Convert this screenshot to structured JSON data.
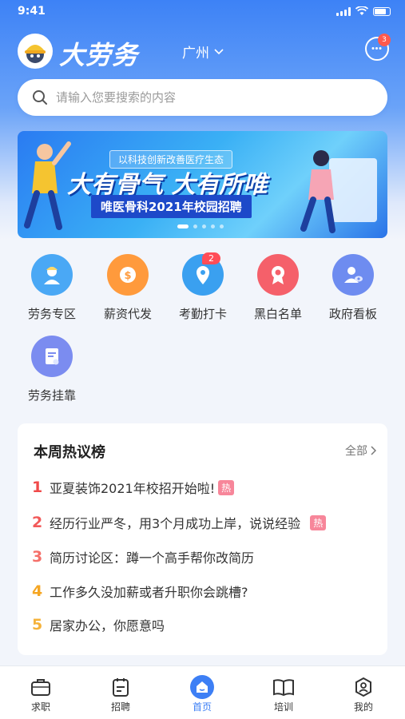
{
  "status_bar": {
    "time": "9:41"
  },
  "header": {
    "brand": "大劳务",
    "city": "广州",
    "message_badge": "3"
  },
  "search": {
    "placeholder": "请输入您要搜索的内容"
  },
  "banner": {
    "subtitle": "以科技创新改善医疗生态",
    "headline": "大有骨气 大有所唯",
    "campaign": "唯医骨科2021年校园招聘",
    "slides": 5,
    "active_slide": 1
  },
  "quick_menu": [
    {
      "label": "劳务专区",
      "icon": "worker-icon",
      "color": "#4aa8f5"
    },
    {
      "label": "薪资代发",
      "icon": "salary-coin-icon",
      "color": "#ff9a3c"
    },
    {
      "label": "考勤打卡",
      "icon": "location-pin-icon",
      "color": "#3aa0f0",
      "badge": "2"
    },
    {
      "label": "黑白名单",
      "icon": "ribbon-badge-icon",
      "color": "#f5606a"
    },
    {
      "label": "政府看板",
      "icon": "person-eye-icon",
      "color": "#6e8cf0"
    },
    {
      "label": "劳务挂靠",
      "icon": "document-icon",
      "color": "#7b8cf0"
    }
  ],
  "hot_list": {
    "title": "本周热议榜",
    "more_label": "全部",
    "hot_tag": "热",
    "items": [
      {
        "rank": "1",
        "text": "亚夏装饰2021年校招开始啦!",
        "hot": true,
        "rank_color": "#f04a4a"
      },
      {
        "rank": "2",
        "text": "经历行业严冬，用3个月成功上岸，说说经验",
        "hot": true,
        "rank_color": "#f25a5a"
      },
      {
        "rank": "3",
        "text": "简历讨论区：蹲一个高手帮你改简历",
        "hot": false,
        "rank_color": "#f5706a"
      },
      {
        "rank": "4",
        "text": "工作多久没加薪或者升职你会跳槽?",
        "hot": false,
        "rank_color": "#f5a623"
      },
      {
        "rank": "5",
        "text": "居家办公，你愿意吗",
        "hot": false,
        "rank_color": "#f5b23a"
      }
    ]
  },
  "tab_bar": [
    {
      "label": "求职",
      "icon": "briefcase-icon",
      "active": false
    },
    {
      "label": "招聘",
      "icon": "clipboard-icon",
      "active": false
    },
    {
      "label": "首页",
      "icon": "home-icon",
      "active": true
    },
    {
      "label": "培训",
      "icon": "book-icon",
      "active": false
    },
    {
      "label": "我的",
      "icon": "profile-icon",
      "active": false
    }
  ],
  "colors": {
    "primary": "#3d7ff5",
    "hot_tag": "#f7869a"
  }
}
